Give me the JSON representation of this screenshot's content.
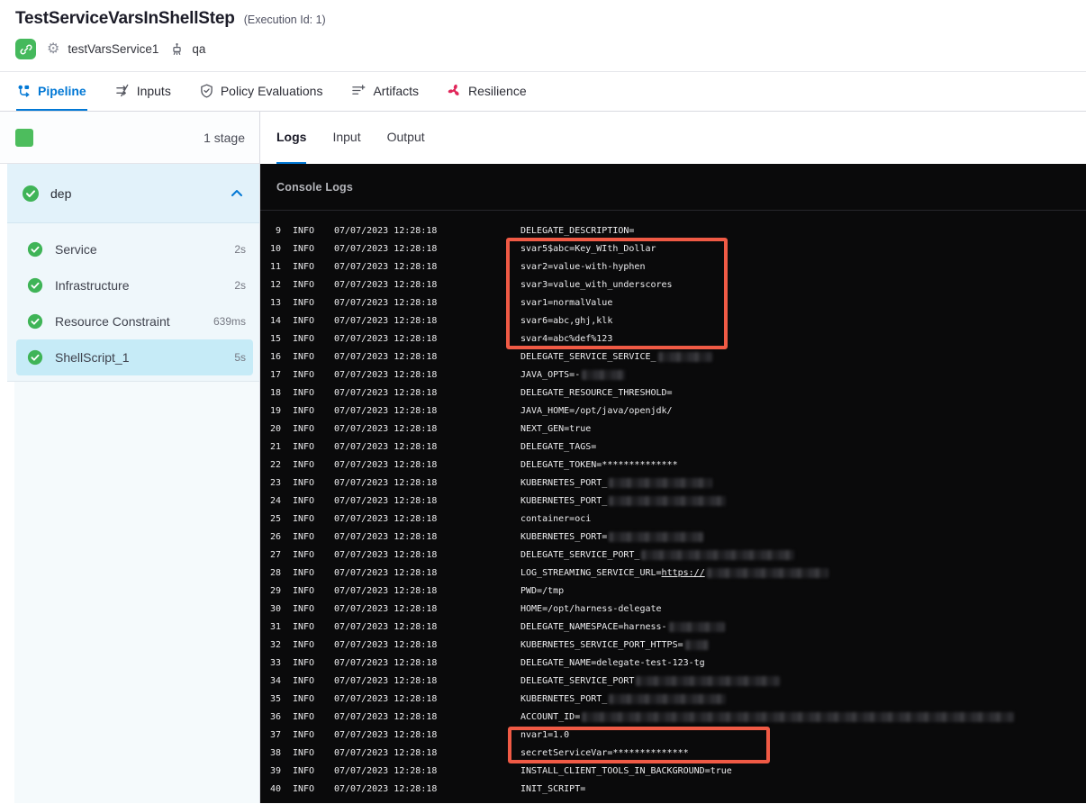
{
  "header": {
    "title": "TestServiceVarsInShellStep",
    "execution_id_label": "(Execution Id: 1)",
    "service_name": "testVarsService1",
    "environment_name": "qa"
  },
  "nav_tabs": [
    {
      "label": "Pipeline",
      "active": true
    },
    {
      "label": "Inputs",
      "active": false
    },
    {
      "label": "Policy Evaluations",
      "active": false
    },
    {
      "label": "Artifacts",
      "active": false
    },
    {
      "label": "Resilience",
      "active": false
    }
  ],
  "sidebar": {
    "stage_count_label": "1 stage",
    "group": {
      "name": "dep",
      "status": "success",
      "expanded": true
    },
    "steps": [
      {
        "name": "Service",
        "duration": "2s",
        "selected": false
      },
      {
        "name": "Infrastructure",
        "duration": "2s",
        "selected": false
      },
      {
        "name": "Resource Constraint",
        "duration": "639ms",
        "selected": false
      },
      {
        "name": "ShellScript_1",
        "duration": "5s",
        "selected": true
      }
    ]
  },
  "log_panel": {
    "tabs": [
      {
        "label": "Logs",
        "active": true
      },
      {
        "label": "Input",
        "active": false
      },
      {
        "label": "Output",
        "active": false
      }
    ],
    "console_title": "Console Logs"
  },
  "logs": {
    "level": "INFO",
    "timestamp": "07/07/2023 12:28:18",
    "lines": [
      {
        "n": 9,
        "segments": [
          {
            "text": "DELEGATE_DESCRIPTION="
          }
        ]
      },
      {
        "n": 10,
        "segments": [
          {
            "text": "svar5$abc=Key_WIth_Dollar"
          }
        ]
      },
      {
        "n": 11,
        "segments": [
          {
            "text": "svar2=value-with-hyphen"
          }
        ]
      },
      {
        "n": 12,
        "segments": [
          {
            "text": "svar3=value_with_underscores"
          }
        ]
      },
      {
        "n": 13,
        "segments": [
          {
            "text": "svar1=normalValue"
          }
        ]
      },
      {
        "n": 14,
        "segments": [
          {
            "text": "svar6=abc,ghj,klk"
          }
        ]
      },
      {
        "n": 15,
        "segments": [
          {
            "text": "svar4=abc%def%123"
          }
        ]
      },
      {
        "n": 16,
        "segments": [
          {
            "text": "DELEGATE_SERVICE_SERVICE_"
          },
          {
            "redacted": 60
          }
        ]
      },
      {
        "n": 17,
        "segments": [
          {
            "text": "JAVA_OPTS=-"
          },
          {
            "redacted": 48
          }
        ]
      },
      {
        "n": 18,
        "segments": [
          {
            "text": "DELEGATE_RESOURCE_THRESHOLD="
          }
        ]
      },
      {
        "n": 19,
        "segments": [
          {
            "text": "JAVA_HOME=/opt/java/openjdk/"
          }
        ]
      },
      {
        "n": 20,
        "segments": [
          {
            "text": "NEXT_GEN=true"
          }
        ]
      },
      {
        "n": 21,
        "segments": [
          {
            "text": "DELEGATE_TAGS="
          }
        ]
      },
      {
        "n": 22,
        "segments": [
          {
            "text": "DELEGATE_TOKEN=**************"
          }
        ]
      },
      {
        "n": 23,
        "segments": [
          {
            "text": "KUBERNETES_PORT_"
          },
          {
            "redacted": 115
          }
        ]
      },
      {
        "n": 24,
        "segments": [
          {
            "text": "KUBERNETES_PORT_"
          },
          {
            "redacted": 130
          }
        ]
      },
      {
        "n": 25,
        "segments": [
          {
            "text": "container=oci"
          }
        ]
      },
      {
        "n": 26,
        "segments": [
          {
            "text": "KUBERNETES_PORT="
          },
          {
            "redacted": 105
          }
        ]
      },
      {
        "n": 27,
        "segments": [
          {
            "text": "DELEGATE_SERVICE_PORT_"
          },
          {
            "redacted": 170
          }
        ]
      },
      {
        "n": 28,
        "segments": [
          {
            "text": "LOG_STREAMING_SERVICE_URL="
          },
          {
            "link": "https://"
          },
          {
            "redacted": 135
          }
        ]
      },
      {
        "n": 29,
        "segments": [
          {
            "text": "PWD=/tmp"
          }
        ]
      },
      {
        "n": 30,
        "segments": [
          {
            "text": "HOME=/opt/harness-delegate"
          }
        ]
      },
      {
        "n": 31,
        "segments": [
          {
            "text": "DELEGATE_NAMESPACE=harness-"
          },
          {
            "redacted": 62
          }
        ]
      },
      {
        "n": 32,
        "segments": [
          {
            "text": "KUBERNETES_SERVICE_PORT_HTTPS="
          },
          {
            "redacted": 26
          }
        ]
      },
      {
        "n": 33,
        "segments": [
          {
            "text": "DELEGATE_NAME=delegate-test-123-tg"
          }
        ]
      },
      {
        "n": 34,
        "segments": [
          {
            "text": "DELEGATE_SERVICE_PORT"
          },
          {
            "redacted": 160
          }
        ]
      },
      {
        "n": 35,
        "segments": [
          {
            "text": "KUBERNETES_PORT_"
          },
          {
            "redacted": 130
          }
        ]
      },
      {
        "n": 36,
        "segments": [
          {
            "text": "ACCOUNT_ID="
          },
          {
            "redacted": 480
          }
        ]
      },
      {
        "n": 37,
        "segments": [
          {
            "text": "nvar1=1.0"
          }
        ]
      },
      {
        "n": 38,
        "segments": [
          {
            "text": "secretServiceVar=**************"
          }
        ]
      },
      {
        "n": 39,
        "segments": [
          {
            "text": "INSTALL_CLIENT_TOOLS_IN_BACKGROUND=true"
          }
        ]
      },
      {
        "n": 40,
        "segments": [
          {
            "text": "INIT_SCRIPT="
          }
        ]
      }
    ]
  },
  "colors": {
    "accent_blue": "#0278d5",
    "success_green": "#45b95c",
    "resilience_pink": "#e0275a",
    "highlight_red": "#f05a45",
    "console_bg": "#0a0a0b",
    "selected_step_bg": "#c6ebf7"
  }
}
